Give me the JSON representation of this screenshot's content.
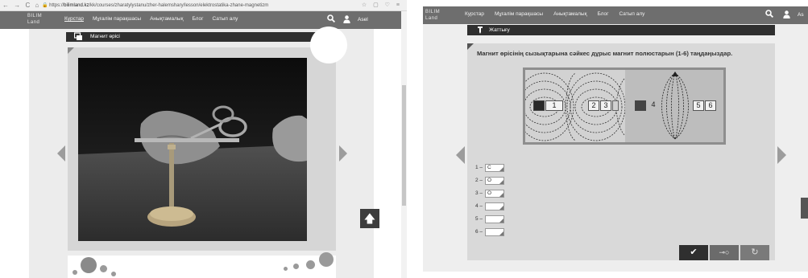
{
  "left": {
    "browser": {
      "nav_glyphs": "← → C ⌂",
      "url_prefix": "🔒 https://",
      "url_host": "bilimland.kz",
      "url_path": "/kk/courses/zharatylystanu/zher-halemshary/lesson/elektrostatika-zhane-magnetizm",
      "right_glyphs": "☆ ▢ ♡ ≡"
    },
    "logo": {
      "line1": "BILIM",
      "line2": "Land"
    },
    "nav": {
      "items": [
        "Курстар",
        "Мұғалім парақшасы",
        "Анықтамалық",
        "Блог",
        "Сатып алу"
      ],
      "search_glyph": "🔍",
      "user_glyph": "👤",
      "username": "Asel"
    },
    "section": {
      "icon": "▣",
      "title": "Магнит өрісі"
    },
    "up_glyph": "🡅"
  },
  "right": {
    "logo": {
      "line1": "BILIM",
      "line2": "Land"
    },
    "nav": {
      "items": [
        "Курстар",
        "Мұғалім парақшасы",
        "Анықтамалық",
        "Блог",
        "Сатып алу"
      ],
      "search_glyph": "🔍",
      "user_glyph": "👤",
      "username": "As"
    },
    "section": {
      "icon": "🖉",
      "title": "Жаттығу"
    },
    "task_title": "Магнит өрісінің сызықтарына сәйкес дұрыс магнит полюстарын (1-6) таңдаңыздар.",
    "poles": [
      "1",
      "2",
      "3",
      "4",
      "5",
      "6"
    ],
    "answers": [
      {
        "label": "1 –",
        "value": "С"
      },
      {
        "label": "2 –",
        "value": "О"
      },
      {
        "label": "3 –",
        "value": "О"
      },
      {
        "label": "4 –",
        "value": ""
      },
      {
        "label": "5 –",
        "value": ""
      },
      {
        "label": "6 –",
        "value": ""
      }
    ],
    "buttons": {
      "check": "✔",
      "key": "⊸○",
      "reset": "↻"
    }
  },
  "icons": {
    "search": "search-icon",
    "user": "user-icon",
    "video": "video-icon",
    "pencil": "pencil-icon",
    "check": "check-icon",
    "key": "key-icon",
    "reset": "reset-icon",
    "arrow_up": "arrow-up-icon"
  }
}
